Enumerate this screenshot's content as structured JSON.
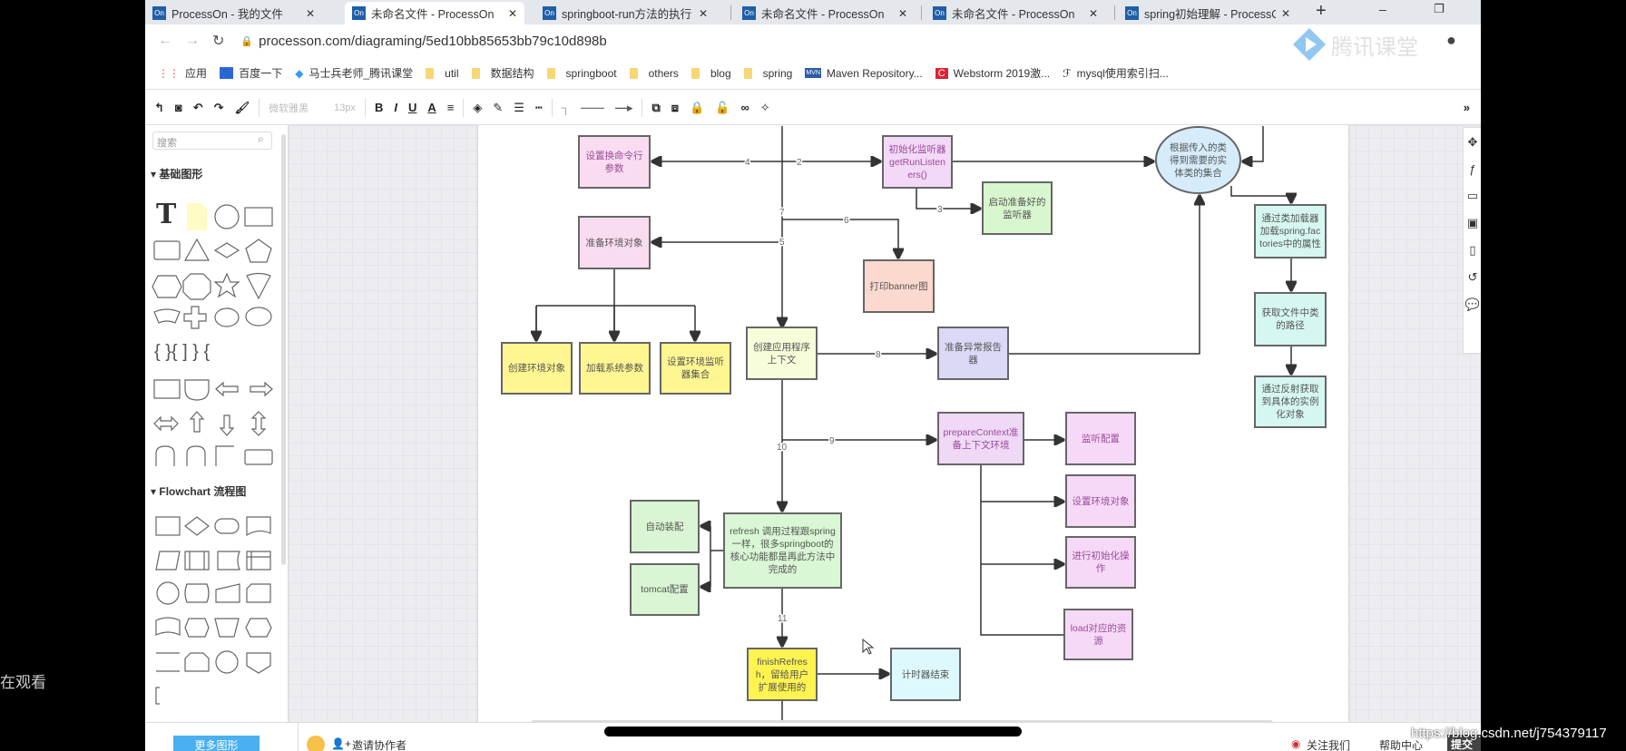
{
  "browser": {
    "tabs": [
      {
        "title": "ProcessOn - 我的文件",
        "favicon": "On"
      },
      {
        "title": "未命名文件 - ProcessOn",
        "favicon": "On",
        "active": true
      },
      {
        "title": "springboot-run方法的执行",
        "favicon": "On"
      },
      {
        "title": "未命名文件 - ProcessOn",
        "favicon": "On"
      },
      {
        "title": "未命名文件 - ProcessOn",
        "favicon": "On"
      },
      {
        "title": "spring初始理解 - ProcessOn",
        "favicon": "On"
      }
    ],
    "new_tab": "+",
    "url": "processon.com/diagraming/5ed10bb85653bb79c10d898b",
    "bookmarks": [
      "应用",
      "百度一下",
      "马士兵老师_腾讯课堂",
      "util",
      "数据结构",
      "springboot",
      "others",
      "blog",
      "spring",
      "Maven Repository...",
      "Webstorm 2019激...",
      "mysql使用索引扫..."
    ]
  },
  "watermark_logo": "腾讯课堂",
  "toolbar": {
    "font": "微软雅黑",
    "font_size": "13px",
    "bold": "B",
    "italic": "I",
    "underline": "U",
    "font_color": "A"
  },
  "sidebar": {
    "search_placeholder": "搜索",
    "section_basic": "基础图形",
    "section_flowchart": "Flowchart 流程图",
    "more_shapes": "更多图形"
  },
  "diagram": {
    "nodes": [
      {
        "text": "设置换命令行参数",
        "color": "#f9dcf0"
      },
      {
        "text": "初始化监听器getRunListeners()",
        "color": "#f2d9f7"
      },
      {
        "text": "根据传入的类得到需要的实体类的集合",
        "color": "#d6ecfa"
      },
      {
        "text": "启动准备好的监听器",
        "color": "#d9f7cf"
      },
      {
        "text": "准备环境对象",
        "color": "#f9dcf0"
      },
      {
        "text": "打印banner图",
        "color": "#fcd9cf"
      },
      {
        "text": "通过类加载器加载spring.factories中的属性",
        "color": "#d6f7f1"
      },
      {
        "text": "获取文件中类的路径",
        "color": "#d6f7f1"
      },
      {
        "text": "通过反射获取到具体的实例化对象",
        "color": "#d6f7f1"
      },
      {
        "text": "创建环境对象",
        "color": "#fff691"
      },
      {
        "text": "加载系统参数",
        "color": "#fff691"
      },
      {
        "text": "设置环境监听器集合",
        "color": "#fff691"
      },
      {
        "text": "创建应用程序上下文",
        "color": "#f7fcd9"
      },
      {
        "text": "准备异常报告器",
        "color": "#dadaf7"
      },
      {
        "text": "prepareContext准备上下文环境",
        "color": "#efd9f7"
      },
      {
        "text": "监听配置",
        "color": "#f6d9f7"
      },
      {
        "text": "设置环境对象",
        "color": "#f6d9f7"
      },
      {
        "text": "进行初始化操作",
        "color": "#f6d9f7"
      },
      {
        "text": "load对应的资源",
        "color": "#f6d9f7"
      },
      {
        "text": "自动装配",
        "color": "#d9f5d4"
      },
      {
        "text": "tomcat配置",
        "color": "#d9f5d4"
      },
      {
        "text": "refresh 调用过程跟spring一样，很多springboot的核心功能都是再此方法中完成的",
        "color": "#d9f7d4"
      },
      {
        "text": "finishRefresh，留给用户扩展使用的",
        "color": "#fff350"
      },
      {
        "text": "计时器结束",
        "color": "#ddf9fd"
      }
    ],
    "edge_labels": [
      "2",
      "3",
      "4",
      "5",
      "6",
      "7",
      "8",
      "9",
      "10",
      "11"
    ]
  },
  "footer": {
    "invite": "邀请协作者",
    "follow": "关注我们",
    "help": "帮助中心",
    "feedback": "提交反"
  },
  "overlay": {
    "watching": "在观看",
    "csdn": "https://blog.csdn.net/j754379117"
  }
}
